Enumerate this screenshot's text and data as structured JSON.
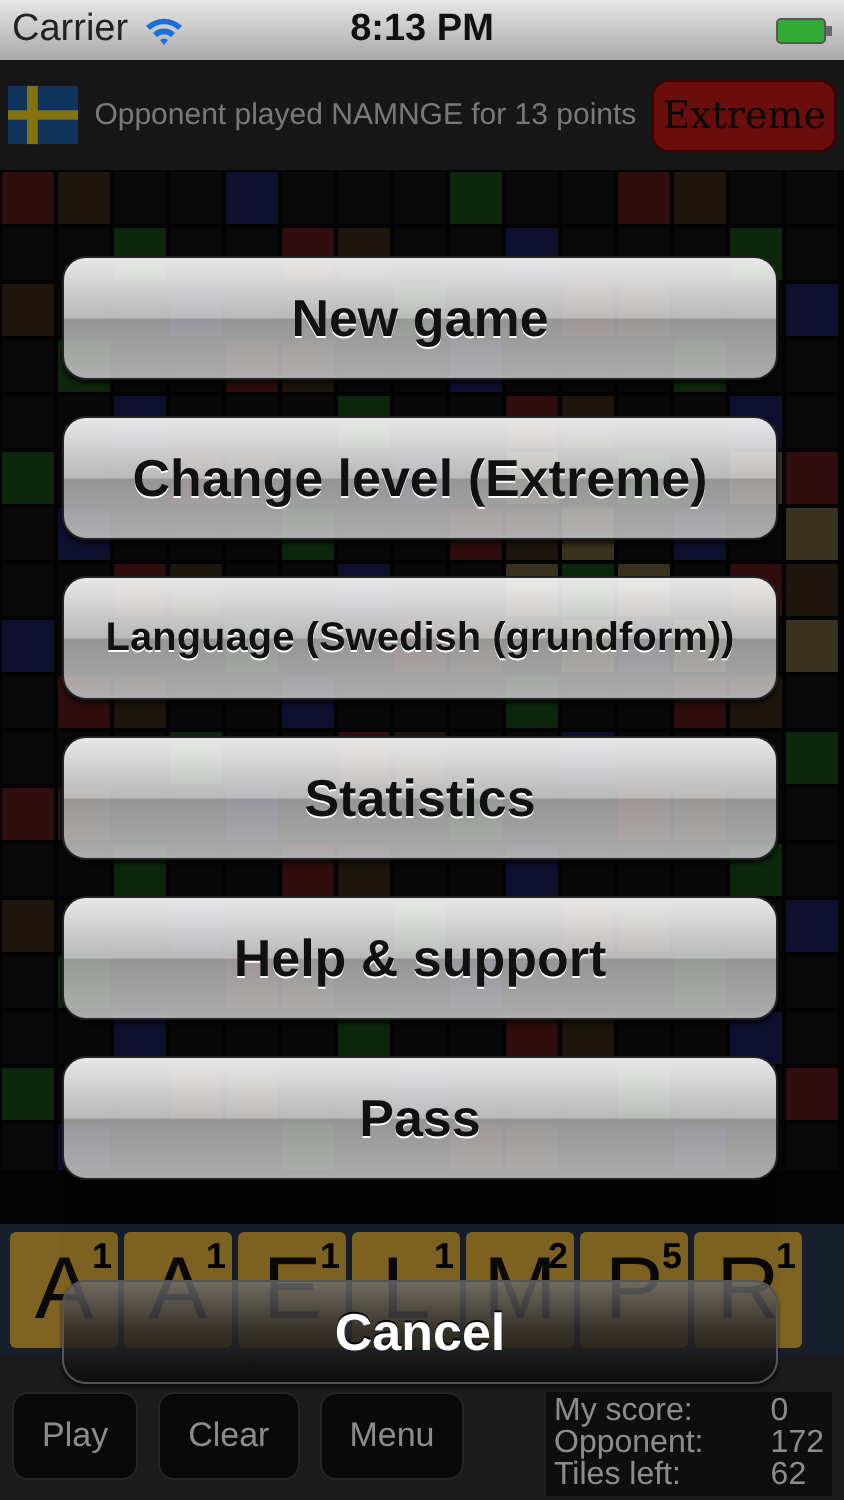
{
  "status_bar": {
    "carrier": "Carrier",
    "time": "8:13 PM"
  },
  "header": {
    "message": "Opponent played NAMNGE for 13 points",
    "level_button": "Extreme"
  },
  "rack": [
    {
      "letter": "A",
      "value": "1"
    },
    {
      "letter": "A",
      "value": "1"
    },
    {
      "letter": "E",
      "value": "1"
    },
    {
      "letter": "L",
      "value": "1"
    },
    {
      "letter": "M",
      "value": "2"
    },
    {
      "letter": "P",
      "value": "5"
    },
    {
      "letter": "R",
      "value": "1"
    }
  ],
  "toolbar": {
    "buttons": [
      "Play",
      "Clear",
      "Menu"
    ]
  },
  "scores": [
    {
      "label": "My score:",
      "value": "0"
    },
    {
      "label": "Opponent:",
      "value": "172"
    },
    {
      "label": "Tiles left:",
      "value": "62"
    }
  ],
  "menu": {
    "items": [
      "New game",
      "Change level (Extreme)",
      "Language (Swedish (grundform))",
      "Statistics",
      "Help & support",
      "Pass"
    ],
    "cancel": "Cancel"
  }
}
